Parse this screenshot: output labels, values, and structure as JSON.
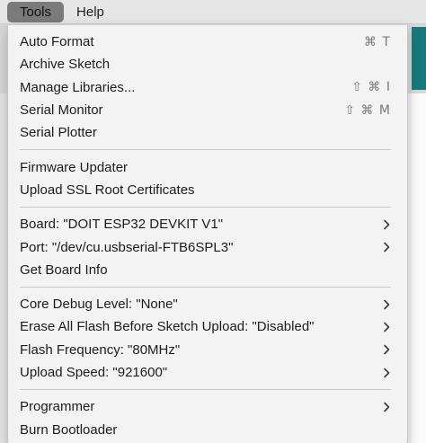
{
  "menubar": {
    "items": [
      {
        "label": "Tools",
        "active": true
      },
      {
        "label": "Help",
        "active": false
      }
    ]
  },
  "tools_menu": {
    "groups": [
      [
        {
          "label": "Auto Format",
          "shortcut": "⌘ T"
        },
        {
          "label": "Archive Sketch"
        },
        {
          "label": "Manage Libraries...",
          "shortcut": "⇧ ⌘ I"
        },
        {
          "label": "Serial Monitor",
          "shortcut": "⇧ ⌘ M"
        },
        {
          "label": "Serial Plotter"
        }
      ],
      [
        {
          "label": "Firmware Updater"
        },
        {
          "label": "Upload SSL Root Certificates"
        }
      ],
      [
        {
          "label": "Board: \"DOIT ESP32 DEVKIT V1\"",
          "submenu": true
        },
        {
          "label": "Port: \"/dev/cu.usbserial-FTB6SPL3\"",
          "submenu": true
        },
        {
          "label": "Get Board Info"
        }
      ],
      [
        {
          "label": "Core Debug Level: \"None\"",
          "submenu": true
        },
        {
          "label": "Erase All Flash Before Sketch Upload: \"Disabled\"",
          "submenu": true
        },
        {
          "label": "Flash Frequency: \"80MHz\"",
          "submenu": true
        },
        {
          "label": "Upload Speed: \"921600\"",
          "submenu": true
        }
      ],
      [
        {
          "label": "Programmer",
          "submenu": true
        },
        {
          "label": "Burn Bootloader"
        }
      ]
    ]
  },
  "icons": {
    "submenu": "chevron-right-icon"
  },
  "colors": {
    "menu_background": "#f3f3f3",
    "active_menubar_item": "#7b7b7b",
    "shortcut_text": "#7a7a7a",
    "window_accent": "#167a7c"
  }
}
